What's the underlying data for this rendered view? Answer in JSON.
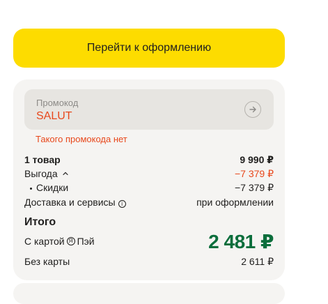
{
  "checkout": {
    "button_label": "Перейти к оформлению"
  },
  "promo": {
    "label": "Промокод",
    "value": "SALUT",
    "error": "Такого промокода нет",
    "submit_icon": "arrow-right-icon"
  },
  "summary": {
    "items_label": "1 товар",
    "items_value": "9 990 ₽",
    "benefit_label": "Выгода",
    "benefit_value": "−7 379 ₽",
    "discount_label": "Скидки",
    "discount_value": "−7 379 ₽",
    "delivery_label": "Доставка и сервисы",
    "delivery_value": "при оформлении",
    "total_title": "Итого",
    "card_label_pre": "С картой",
    "card_label_post": "Пэй",
    "card_price": "2 481 ₽",
    "nocard_label": "Без карты",
    "nocard_value": "2 611 ₽"
  },
  "colors": {
    "accent_yellow": "#fddc00",
    "error_red": "#e8481c",
    "price_green": "#0b6e3c"
  }
}
